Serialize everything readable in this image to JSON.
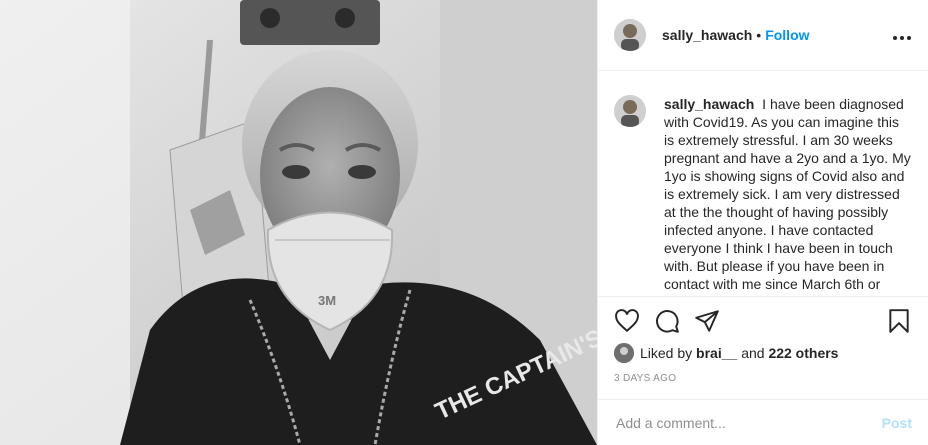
{
  "post": {
    "username": "sally_hawach",
    "follow_label": "Follow",
    "separator": "•",
    "more_icon": "more-horizontal-icon"
  },
  "photo": {
    "mask_brand": "3M",
    "shirt_text": "THE CAPTAIN'S RIDE"
  },
  "caption": {
    "username": "sally_hawach",
    "text": "I have been diagnosed with Covid19. As you can imagine this is extremely stressful. I am 30 weeks pregnant and have a 2yo and a 1yo. My 1yo is showing signs of Covid also and is extremely sick. I am very distressed at the the thought of having possibly infected anyone. I have contacted everyone I think I have been in touch with. But please if you have been in contact with me since March 6th or"
  },
  "actions": {
    "icons": [
      "heart-icon",
      "comment-icon",
      "share-icon",
      "bookmark-icon"
    ]
  },
  "likes": {
    "prefix": "Liked by",
    "user": "brai__",
    "conj": "and",
    "others": "222 others"
  },
  "timestamp": "3 DAYS AGO",
  "comment_box": {
    "placeholder": "Add a comment...",
    "post_label": "Post"
  },
  "colors": {
    "accent": "#0095f6",
    "post_disabled": "#b2dffc",
    "muted": "#8e8e8e"
  }
}
